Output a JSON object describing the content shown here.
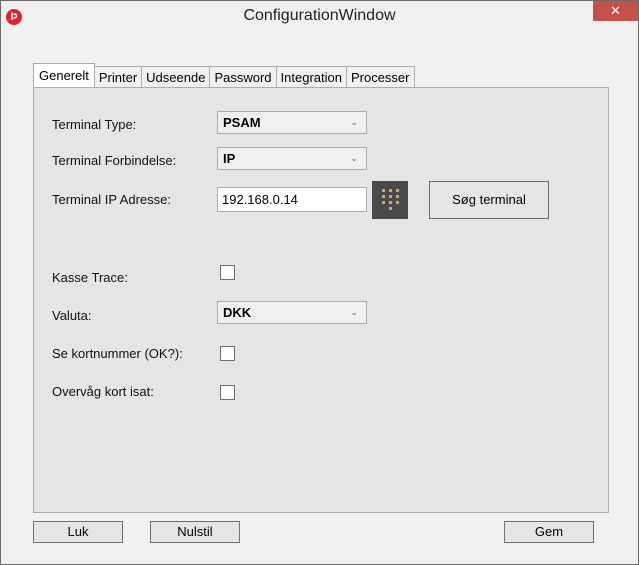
{
  "window": {
    "title": "ConfigurationWindow",
    "close_glyph": "✕",
    "app_icon_glyph": "Þ"
  },
  "tabs": [
    {
      "label": "Generelt",
      "active": true
    },
    {
      "label": "Printer"
    },
    {
      "label": "Udseende"
    },
    {
      "label": "Password"
    },
    {
      "label": "Integration"
    },
    {
      "label": "Processer"
    }
  ],
  "form": {
    "terminal_type": {
      "label": "Terminal Type:",
      "value": "PSAM"
    },
    "terminal_connection": {
      "label": "Terminal Forbindelse:",
      "value": "IP"
    },
    "terminal_ip": {
      "label": "Terminal IP Adresse:",
      "value": "192.168.0.14"
    },
    "search_terminal_button": "Søg terminal",
    "kasse_trace": {
      "label": "Kasse Trace:",
      "checked": false
    },
    "currency": {
      "label": "Valuta:",
      "value": "DKK"
    },
    "show_card_number": {
      "label": "Se kortnummer (OK?):",
      "checked": false
    },
    "monitor_card": {
      "label": "Overvåg kort isat:",
      "checked": false
    }
  },
  "footer": {
    "close_button": "Luk",
    "reset_button": "Nulstil",
    "save_button": "Gem"
  },
  "icons": {
    "dropdown": "chevron-down-icon",
    "keypad": "keypad-icon",
    "app": "app-logo-icon"
  },
  "colors": {
    "close_button_bg": "#c7504b",
    "app_icon_bg": "#e0242b",
    "keypad_bg": "#4a4a4a",
    "keypad_digits": "#c8a96a"
  }
}
